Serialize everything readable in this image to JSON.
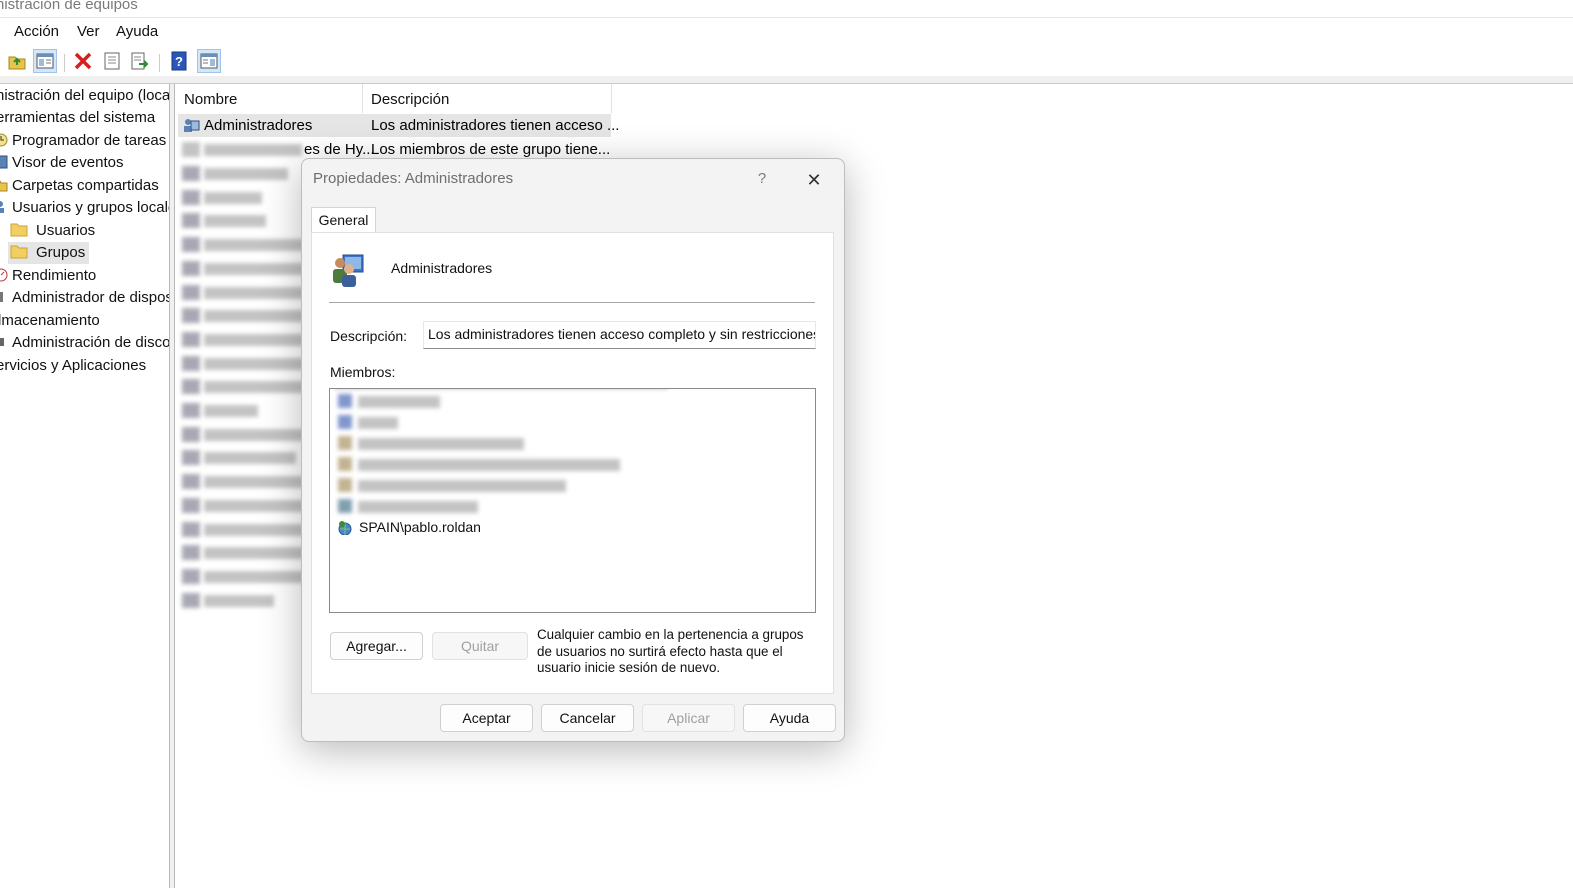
{
  "window": {
    "title": "nistración de equipos"
  },
  "menu": [
    "Acción",
    "Ver",
    "Ayuda"
  ],
  "toolbar_icons": [
    "up-folder-icon",
    "show-hide-tree-icon",
    "delete-icon",
    "properties-icon",
    "export-list-icon",
    "help-icon",
    "show-hide-action-pane-icon"
  ],
  "tree": [
    {
      "label": "nistración del equipo (loca",
      "icon": "computer-icon"
    },
    {
      "label": "erramientas del sistema",
      "icon": "tools-icon"
    },
    {
      "label": "Programador de tareas",
      "icon": "clock-icon"
    },
    {
      "label": "Visor de eventos",
      "icon": "event-viewer-icon"
    },
    {
      "label": "Carpetas compartidas",
      "icon": "shared-folder-icon"
    },
    {
      "label": "Usuarios y grupos locale",
      "icon": "users-icon"
    },
    {
      "label": "Usuarios",
      "icon": "folder-icon"
    },
    {
      "label": "Grupos",
      "icon": "folder-icon",
      "selected": true
    },
    {
      "label": "Rendimiento",
      "icon": "performance-icon"
    },
    {
      "label": "Administrador de dispos",
      "icon": "device-manager-icon"
    },
    {
      "label": "lmacenamiento",
      "icon": "storage-icon"
    },
    {
      "label": "Administración de disco",
      "icon": "disk-icon"
    },
    {
      "label": "ervicios y Aplicaciones",
      "icon": "services-icon"
    }
  ],
  "list": {
    "columns": [
      "Nombre",
      "Descripción"
    ],
    "rows": [
      {
        "name": "Administradores",
        "desc": "Los administradores tienen acceso ..."
      },
      {
        "name": "es de Hy...",
        "desc": "Los miembros de este grupo tiene..."
      }
    ]
  },
  "dialog": {
    "title": "Propiedades: Administradores",
    "help_glyph": "?",
    "close_glyph": "✕",
    "tab": "General",
    "group_name": "Administradores",
    "description_label": "Descripción:",
    "description_value": "Los administradores tienen acceso completo y sin restricciones al",
    "members_label": "Miembros:",
    "visible_member": "SPAIN\\pablo.roldan",
    "add_button": "Agregar...",
    "remove_button": "Quitar",
    "note": "Cualquier cambio en la pertenencia a grupos de usuarios no surtirá efecto hasta que el usuario inicie sesión de nuevo.",
    "ok_button": "Aceptar",
    "cancel_button": "Cancelar",
    "apply_button": "Aplicar",
    "help_button": "Ayuda"
  }
}
